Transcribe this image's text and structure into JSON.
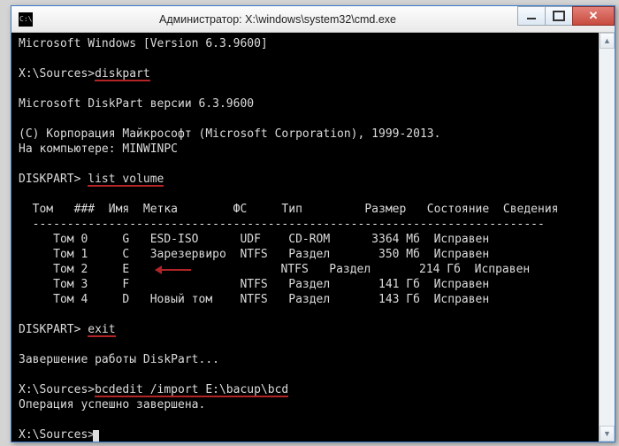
{
  "window": {
    "title": "Администратор: X:\\windows\\system32\\cmd.exe"
  },
  "lines": {
    "l0": "Microsoft Windows [Version 6.3.9600]",
    "l1": "",
    "l2a": "X:\\Sources>",
    "l2b": "diskpart",
    "l3": "",
    "l4": "Microsoft DiskPart версии 6.3.9600",
    "l5": "",
    "l6": "(C) Корпорация Майкрософт (Microsoft Corporation), 1999-2013.",
    "l7": "На компьютере: MINWINPC",
    "l8": "",
    "l9a": "DISKPART> ",
    "l9b": "list volume",
    "l10": "",
    "l11": "  Том   ###  Имя  Метка        ФС     Тип         Размер   Состояние  Сведения",
    "l12": "  --------------------------------------------------------------------------",
    "l13": "     Том 0     G   ESD-ISO      UDF    CD-ROM      3364 Мб  Исправен",
    "l14": "     Том 1     C   Зарезервиро  NTFS   Раздел       350 Мб  Исправен",
    "l15a": "     Том 2     E   ",
    "l15b": "             NTFS   Раздел       214 Гб  Исправен",
    "l16": "     Том 3     F                NTFS   Раздел       141 Гб  Исправен",
    "l17": "     Том 4     D   Новый том    NTFS   Раздел       143 Гб  Исправен",
    "l18": "",
    "l19a": "DISKPART> ",
    "l19b": "exit",
    "l20": "",
    "l21": "Завершение работы DiskPart...",
    "l22": "",
    "l23a": "X:\\Sources>",
    "l23b": "bcdedit /import E:\\bacup\\bcd",
    "l24": "Операция успешно завершена.",
    "l25": "",
    "l26": "X:\\Sources>"
  }
}
